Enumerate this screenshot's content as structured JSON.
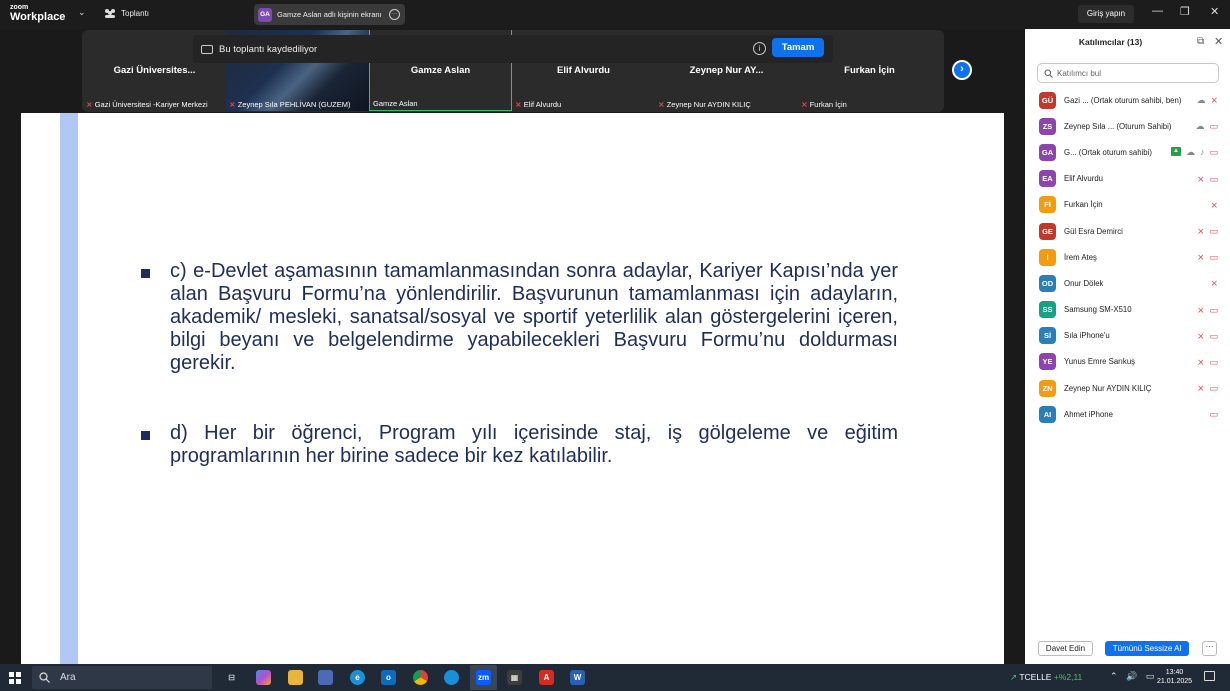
{
  "titlebar": {
    "logo_top": "zoom",
    "logo_bottom": "Workplace",
    "meeting_label": "Toplantı",
    "share_avatar": "GA",
    "share_label": "Gamze Aslan adlı kişinin ekranı",
    "signin": "Giriş yapın",
    "minimize": "—",
    "restore": "❐",
    "close": "✕"
  },
  "recording": {
    "message": "Bu toplantı kaydediliyor",
    "info": "i",
    "ok_label": "Tamam"
  },
  "tiles": [
    {
      "name": "Gazi  Üniversites...",
      "caption": "Gazi Üniversitesi -Kariyer Merkezi",
      "muted": true
    },
    {
      "name": "",
      "caption": "Zeynep Sıla PEHLİVAN (GUZEM)",
      "muted": true
    },
    {
      "name": "Gamze Aslan",
      "caption": "Gamze Aslan",
      "muted": false
    },
    {
      "name": "Elif Alvurdu",
      "caption": "Elif Alvurdu",
      "muted": true
    },
    {
      "name": "Zeynep  Nur  AY...",
      "caption": "Zeynep Nur AYDIN KILIÇ",
      "muted": true
    },
    {
      "name": "Furkan İçin",
      "caption": "Furkan İçin",
      "muted": true
    }
  ],
  "next_arrow": "›",
  "slide": {
    "bullet_c": "c) e-Devlet aşamasının tamamlanmasından sonra adaylar, Kariyer Kapısı’nda yer alan Başvuru Formu’na yönlendirilir. Başvurunun tamamlanması için adayların, akademik/ mesleki, sanatsal/sosyal ve sportif yeterlilik alan göstergelerini içeren, bilgi beyanı ve belgelendirme yapabilecekleri Başvuru Formu’nu doldurması gerekir.",
    "bullet_d": "d) Her bir öğrenci, Program yılı içerisinde staj, iş gölgeleme ve eğitim programlarının her birine sadece bir kez katılabilir."
  },
  "participants_panel": {
    "title": "Katılımcılar (13)",
    "popout": "⧉",
    "close": "✕",
    "search_placeholder": "Katılımcı bul",
    "participants": [
      {
        "initials": "GÜ",
        "color": "#c0392b",
        "name": "Gazi ...  (Ortak oturum sahibi, ben)",
        "icons": "cloud,mic"
      },
      {
        "initials": "ZS",
        "color": "#8e44ad",
        "name": "Zeynep Sıla ...  (Oturum Sahibi)",
        "icons": "cloud,cam"
      },
      {
        "initials": "GA",
        "color": "#8e44ad",
        "name": "G...  (Ortak oturum sahibi)",
        "icons": "share,cloud,micon,cam"
      },
      {
        "initials": "EA",
        "color": "#8e44ad",
        "name": "Elif Alvurdu",
        "icons": "mic,cam"
      },
      {
        "initials": "Fİ",
        "color": "#f39c12",
        "name": "Furkan İçin",
        "icons": "mic"
      },
      {
        "initials": "GE",
        "color": "#c0392b",
        "name": "Gül Esra Demirci",
        "icons": "mic,cam"
      },
      {
        "initials": "İ",
        "color": "#f39c12",
        "name": "İrem Ateş",
        "icons": "mic,cam"
      },
      {
        "initials": "OD",
        "color": "#2980b9",
        "name": "Onur Dölek",
        "icons": "mic"
      },
      {
        "initials": "SS",
        "color": "#16a085",
        "name": "Samsung SM-X510",
        "icons": "mic,cam"
      },
      {
        "initials": "Sİ",
        "color": "#2980b9",
        "name": "Sıla iPhone'u",
        "icons": "mic,cam"
      },
      {
        "initials": "YE",
        "color": "#8e44ad",
        "name": "Yunus Emre Sarıkuş",
        "icons": "mic,cam"
      },
      {
        "initials": "ZN",
        "color": "#f39c12",
        "name": "Zeynep Nur AYDIN KILIÇ",
        "icons": "mic,cam"
      },
      {
        "initials": "AI",
        "color": "#2980b9",
        "name": "Ahmet iPhone",
        "icons": "cam"
      }
    ],
    "invite_label": "Davet Edin",
    "mute_all_label": "Tümünü Sessize Al",
    "more_label": "···"
  },
  "taskbar": {
    "search_label": "Ara",
    "stock_name": "TCELLE",
    "stock_change": "+%2,11",
    "time": "13:40",
    "date": "21.01.2025"
  }
}
